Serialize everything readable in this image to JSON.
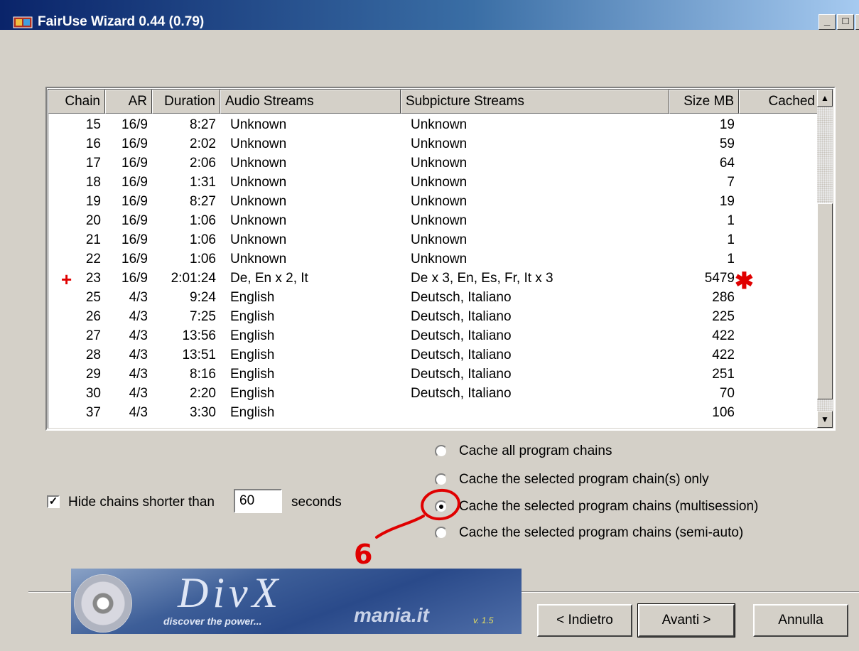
{
  "window": {
    "title": "FairUse Wizard 0.44 (0.79)",
    "min_glyph": "_",
    "max_glyph": "□",
    "close_glyph": "×"
  },
  "table": {
    "headers": [
      "Chain",
      "AR",
      "Duration",
      "Audio Streams",
      "Subpicture Streams",
      "Size MB",
      "Cached"
    ],
    "rows": [
      {
        "chain": "15",
        "ar": "16/9",
        "duration": "8:27",
        "audio": "Unknown",
        "subpicture": "Unknown",
        "size": "19",
        "cached": ""
      },
      {
        "chain": "16",
        "ar": "16/9",
        "duration": "2:02",
        "audio": "Unknown",
        "subpicture": "Unknown",
        "size": "59",
        "cached": ""
      },
      {
        "chain": "17",
        "ar": "16/9",
        "duration": "2:06",
        "audio": "Unknown",
        "subpicture": "Unknown",
        "size": "64",
        "cached": ""
      },
      {
        "chain": "18",
        "ar": "16/9",
        "duration": "1:31",
        "audio": "Unknown",
        "subpicture": "Unknown",
        "size": "7",
        "cached": ""
      },
      {
        "chain": "19",
        "ar": "16/9",
        "duration": "8:27",
        "audio": "Unknown",
        "subpicture": "Unknown",
        "size": "19",
        "cached": ""
      },
      {
        "chain": "20",
        "ar": "16/9",
        "duration": "1:06",
        "audio": "Unknown",
        "subpicture": "Unknown",
        "size": "1",
        "cached": ""
      },
      {
        "chain": "21",
        "ar": "16/9",
        "duration": "1:06",
        "audio": "Unknown",
        "subpicture": "Unknown",
        "size": "1",
        "cached": ""
      },
      {
        "chain": "22",
        "ar": "16/9",
        "duration": "1:06",
        "audio": "Unknown",
        "subpicture": "Unknown",
        "size": "1",
        "cached": ""
      },
      {
        "chain": "23",
        "ar": "16/9",
        "duration": "2:01:24",
        "audio": "De, En x 2, It",
        "subpicture": "De x 3, En, Es, Fr, It x 3",
        "size": "5479",
        "cached": ""
      },
      {
        "chain": "25",
        "ar": "4/3",
        "duration": "9:24",
        "audio": "English",
        "subpicture": "Deutsch, Italiano",
        "size": "286",
        "cached": ""
      },
      {
        "chain": "26",
        "ar": "4/3",
        "duration": "7:25",
        "audio": "English",
        "subpicture": "Deutsch, Italiano",
        "size": "225",
        "cached": ""
      },
      {
        "chain": "27",
        "ar": "4/3",
        "duration": "13:56",
        "audio": "English",
        "subpicture": "Deutsch, Italiano",
        "size": "422",
        "cached": ""
      },
      {
        "chain": "28",
        "ar": "4/3",
        "duration": "13:51",
        "audio": "English",
        "subpicture": "Deutsch, Italiano",
        "size": "422",
        "cached": ""
      },
      {
        "chain": "29",
        "ar": "4/3",
        "duration": "8:16",
        "audio": "English",
        "subpicture": "Deutsch, Italiano",
        "size": "251",
        "cached": ""
      },
      {
        "chain": "30",
        "ar": "4/3",
        "duration": "2:20",
        "audio": "English",
        "subpicture": "Deutsch, Italiano",
        "size": "70",
        "cached": ""
      },
      {
        "chain": "37",
        "ar": "4/3",
        "duration": "3:30",
        "audio": "English",
        "subpicture": "",
        "size": "106",
        "cached": ""
      }
    ],
    "scroll_up_glyph": "▲",
    "scroll_down_glyph": "▼"
  },
  "options": {
    "hide_short_checked": true,
    "check_glyph": "✓",
    "hide_short_label": "Hide chains shorter than",
    "hide_short_value": "60",
    "seconds_label": "seconds",
    "cache_options": [
      {
        "label": "Cache all program chains",
        "selected": false
      },
      {
        "label": "Cache the selected program chain(s) only",
        "selected": false
      },
      {
        "label": "Cache the selected program chains (multisession)",
        "selected": true
      },
      {
        "label": "Cache the selected program chains (semi-auto)",
        "selected": false
      }
    ]
  },
  "banner": {
    "logo_text": "DivX",
    "site_text": "mania.it",
    "version": "v. 1.5",
    "slogan": "discover the power..."
  },
  "buttons": {
    "back": "< Indietro",
    "next": "Avanti >",
    "cancel": "Annulla"
  },
  "annotations": {
    "plus_mark": "+",
    "asterisk_mark": "✱",
    "step_number": "6",
    "color": "#e00000"
  }
}
